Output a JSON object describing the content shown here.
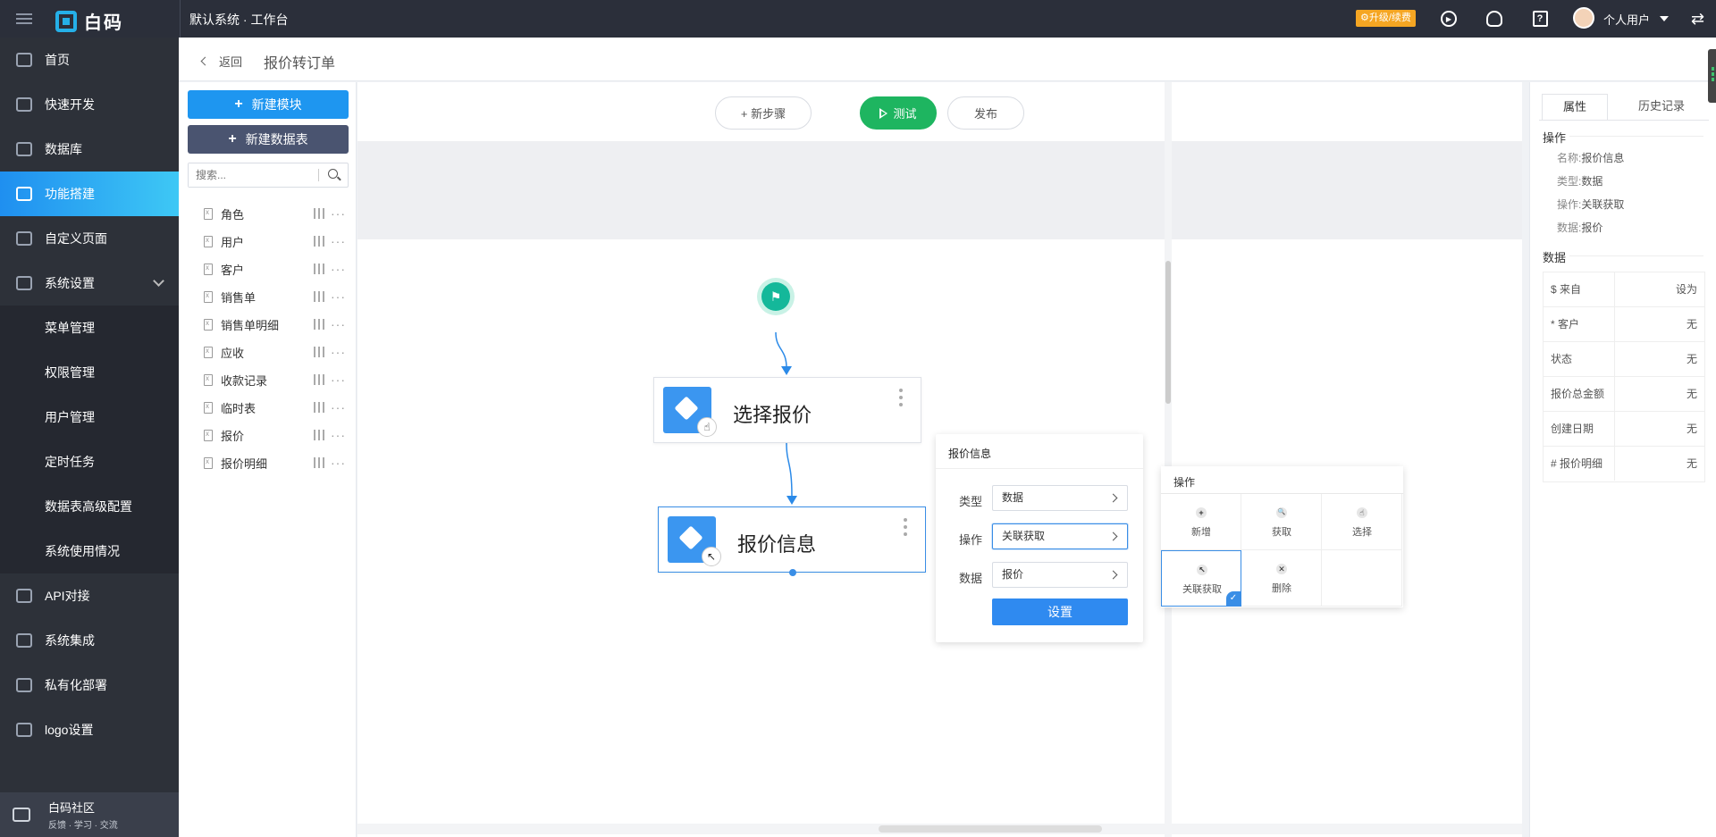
{
  "topbar": {
    "brand": "白码",
    "workspace": "默认系统 · 工作台",
    "upgrade_label": "⚙升级/续费",
    "play_icon": "play-circle-icon",
    "support_icon": "headset-icon",
    "help_label": "?",
    "username": "个人用户",
    "swap_label": "⇄"
  },
  "sidebar": {
    "items": [
      {
        "label": "首页"
      },
      {
        "label": "快速开发"
      },
      {
        "label": "数据库"
      },
      {
        "label": "功能搭建"
      },
      {
        "label": "自定义页面"
      },
      {
        "label": "系统设置"
      },
      {
        "label": "菜单管理"
      },
      {
        "label": "权限管理"
      },
      {
        "label": "用户管理"
      },
      {
        "label": "定时任务"
      },
      {
        "label": "数据表高级配置"
      },
      {
        "label": "系统使用情况"
      },
      {
        "label": "API对接"
      },
      {
        "label": "系统集成"
      },
      {
        "label": "私有化部署"
      },
      {
        "label": "logo设置"
      }
    ],
    "community_title": "白码社区",
    "community_sub": "反馈 · 学习 · 交流"
  },
  "header": {
    "back_label": "返回",
    "title": "报价转订单"
  },
  "modules": {
    "new_module": "新建模块",
    "new_table": "新建数据表",
    "search_placeholder": "搜索...",
    "items": [
      "角色",
      "用户",
      "客户",
      "销售单",
      "销售单明细",
      "应收",
      "收款记录",
      "临时表",
      "报价",
      "报价明细"
    ]
  },
  "canvas": {
    "new_step": "+ 新步骤",
    "test": "测试",
    "publish": "发布",
    "node1": "选择报价",
    "node2": "报价信息"
  },
  "info_panel": {
    "title": "报价信息",
    "type_label": "类型",
    "type_value": "数据",
    "op_label": "操作",
    "op_value": "关联获取",
    "data_label": "数据",
    "data_value": "报价",
    "set_button": "设置"
  },
  "op_panel": {
    "title": "操作",
    "ops": [
      "新增",
      "获取",
      "选择",
      "关联获取",
      "删除"
    ],
    "glyphs": [
      "+",
      "🔍",
      "☝",
      "↖",
      "✕"
    ]
  },
  "right_panel": {
    "tab_props": "属性",
    "tab_history": "历史记录",
    "op_section": "操作",
    "name_key": "名称:",
    "name_val": "报价信息",
    "type_key": "类型:",
    "type_val": "数据",
    "op_key": "操作:",
    "op_val": "关联获取",
    "data_key": "数据:",
    "data_val": "报价",
    "data_section": "数据",
    "rows": [
      {
        "field": "$ 来自",
        "value": "设为"
      },
      {
        "field": "* 客户",
        "value": "无"
      },
      {
        "field": "状态",
        "value": "无"
      },
      {
        "field": "报价总金额",
        "value": "无"
      },
      {
        "field": "创建日期",
        "value": "无"
      },
      {
        "field": "# 报价明细",
        "value": "无"
      }
    ]
  }
}
